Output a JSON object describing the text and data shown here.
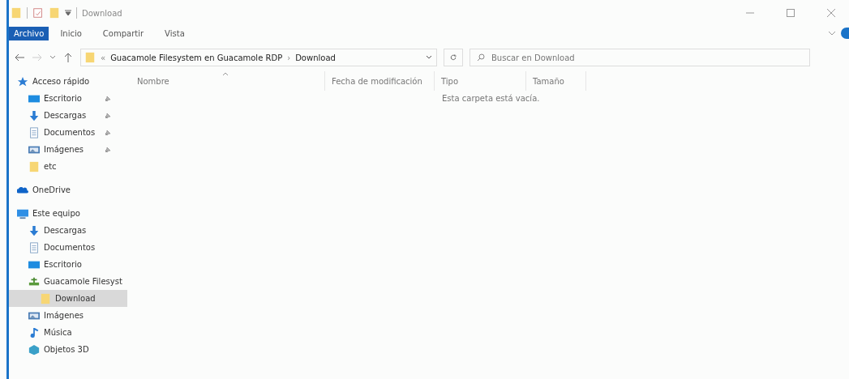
{
  "window": {
    "title": "Download"
  },
  "ribbon_tabs": [
    {
      "label": "Archivo",
      "selected": true
    },
    {
      "label": "Inicio",
      "selected": false
    },
    {
      "label": "Compartir",
      "selected": false
    },
    {
      "label": "Vista",
      "selected": false
    }
  ],
  "address_bar": {
    "path": [
      "«",
      "Guacamole Filesystem en Guacamole RDP",
      "›",
      "Download"
    ]
  },
  "search": {
    "placeholder": "Buscar en Download"
  },
  "sidebar": {
    "items": [
      {
        "label": "Acceso rápido",
        "kind": "star",
        "selected": false,
        "children": [
          {
            "label": "Escritorio",
            "kind": "desktop",
            "pinned": true,
            "selected": false
          },
          {
            "label": "Descargas",
            "kind": "download",
            "pinned": true,
            "selected": false
          },
          {
            "label": "Documentos",
            "kind": "document",
            "pinned": true,
            "selected": false
          },
          {
            "label": "Imágenes",
            "kind": "pictures",
            "pinned": true,
            "selected": false
          },
          {
            "label": "etc",
            "kind": "folder",
            "pinned": false,
            "selected": false
          }
        ]
      },
      {
        "label": "OneDrive",
        "kind": "cloud",
        "selected": false
      },
      {
        "label": "Este equipo",
        "kind": "computer",
        "selected": false,
        "children": [
          {
            "label": "Descargas",
            "kind": "download",
            "selected": false
          },
          {
            "label": "Documentos",
            "kind": "document",
            "selected": false
          },
          {
            "label": "Escritorio",
            "kind": "desktop",
            "selected": false
          },
          {
            "label": "Guacamole Filesyst",
            "kind": "network",
            "selected": false,
            "children": [
              {
                "label": "Download",
                "kind": "folder",
                "selected": true
              }
            ]
          },
          {
            "label": "Imágenes",
            "kind": "pictures",
            "selected": false
          },
          {
            "label": "Música",
            "kind": "music",
            "selected": false
          },
          {
            "label": "Objetos 3D",
            "kind": "cube",
            "selected": false
          }
        ]
      }
    ]
  },
  "table": {
    "columns": [
      "Nombre",
      "Fecha de modificación",
      "Tipo",
      "Tamaño"
    ],
    "empty_message": "Esta carpeta está vacía."
  }
}
